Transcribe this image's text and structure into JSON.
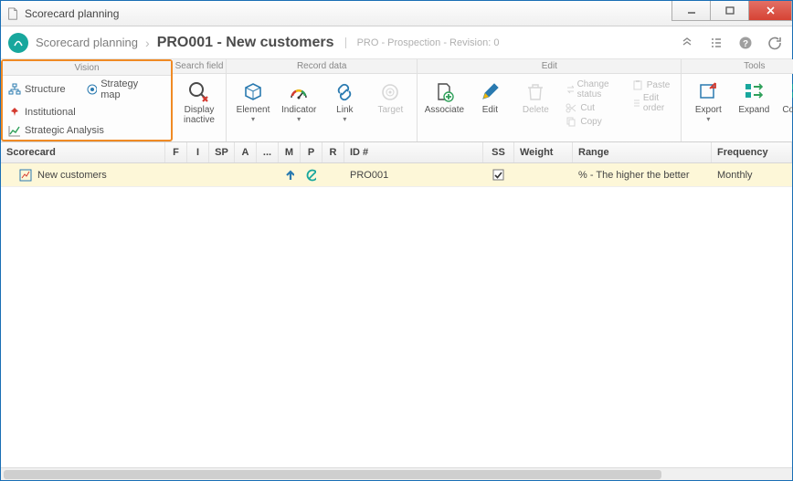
{
  "window": {
    "title": "Scorecard planning"
  },
  "breadcrumb": {
    "parent": "Scorecard planning",
    "current": "PRO001 - New customers",
    "subtitle": "PRO - Prospection - Revision: 0"
  },
  "ribbon": {
    "vision": {
      "title": "Vision",
      "structure": "Structure",
      "strategy_map": "Strategy map",
      "institutional": "Institutional",
      "strategic_analysis": "Strategic Analysis"
    },
    "search_field": {
      "title": "Search field",
      "display_inactive": "Display inactive"
    },
    "record_data": {
      "title": "Record data",
      "element": "Element",
      "indicator": "Indicator",
      "link": "Link",
      "target": "Target"
    },
    "edit": {
      "title": "Edit",
      "associate": "Associate",
      "edit": "Edit",
      "delete": "Delete",
      "change_status": "Change status",
      "cut": "Cut",
      "copy": "Copy",
      "paste": "Paste",
      "edit_order": "Edit order"
    },
    "tools": {
      "title": "Tools",
      "export": "Export",
      "expand": "Expand",
      "collapse": "Collapse"
    }
  },
  "columns": {
    "scorecard": "Scorecard",
    "f": "F",
    "i": "I",
    "sp": "SP",
    "a": "A",
    "dots": "...",
    "m": "M",
    "p": "P",
    "r": "R",
    "id": "ID #",
    "ss": "SS",
    "weight": "Weight",
    "range": "Range",
    "frequency": "Frequency"
  },
  "rows": [
    {
      "scorecard": "New customers",
      "id": "PRO001",
      "ss_checked": true,
      "range": "% - The higher the better",
      "frequency": "Monthly"
    }
  ]
}
